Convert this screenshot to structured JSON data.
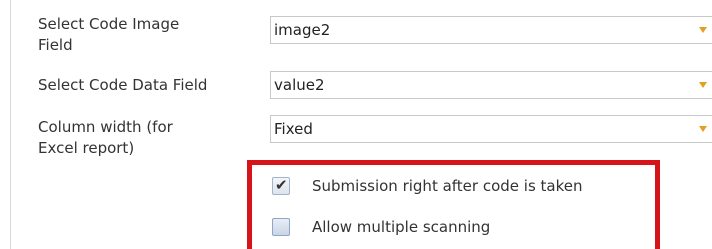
{
  "fields": {
    "code_image": {
      "label": "Select Code Image\nField",
      "value": "image2"
    },
    "code_data": {
      "label": "Select Code Data Field",
      "value": "value2"
    },
    "column_width": {
      "label": "Column width (for\nExcel report)",
      "value": "Fixed"
    }
  },
  "options": {
    "submission_after_code": {
      "label": "Submission right after code is taken",
      "checked": true
    },
    "allow_multiple_scanning": {
      "label": "Allow multiple scanning",
      "checked": false
    }
  },
  "colors": {
    "highlight": "#d8141b",
    "dropdown_arrow": "#e0a020"
  },
  "icons": {
    "dropdown": "chevron-down-icon",
    "check": "checkmark-icon"
  }
}
